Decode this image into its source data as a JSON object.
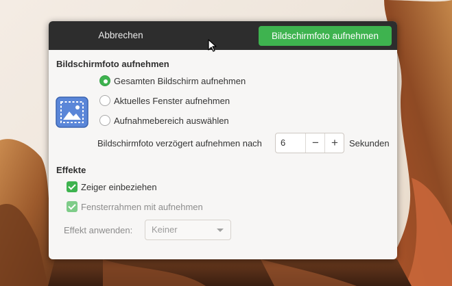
{
  "header": {
    "cancel_label": "Abbrechen",
    "take_label": "Bildschirmfoto aufnehmen",
    "accent": "#3eb34f"
  },
  "capture": {
    "title": "Bildschirmfoto aufnehmen",
    "icon": "screenshot-app-icon",
    "options": [
      {
        "label": "Gesamten Bildschirm aufnehmen",
        "selected": true
      },
      {
        "label": "Aktuelles Fenster aufnehmen",
        "selected": false
      },
      {
        "label": "Aufnahmebereich auswählen",
        "selected": false
      }
    ],
    "delay_label": "Bildschirmfoto verzögert aufnehmen nach",
    "delay_value": "6",
    "decrement_symbol": "−",
    "increment_symbol": "+",
    "delay_units": "Sekunden"
  },
  "effects": {
    "title": "Effekte",
    "include_pointer": {
      "label": "Zeiger einbeziehen",
      "checked": true
    },
    "include_border": {
      "label": "Fensterrahmen mit aufnehmen",
      "checked": true,
      "enabled": false
    },
    "apply_effect_label": "Effekt anwenden:",
    "apply_effect_value": "Keiner"
  }
}
